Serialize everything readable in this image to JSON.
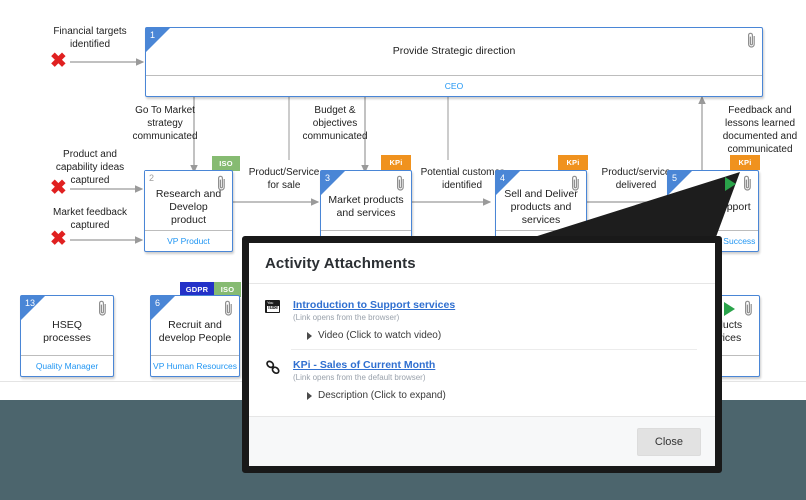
{
  "diagram": {
    "boxes": [
      {
        "num": "1",
        "title": "Provide Strategic direction",
        "role": "CEO",
        "badges": [],
        "has_clip": true,
        "has_play": false
      },
      {
        "num": "2",
        "title": "Research and Develop product",
        "role": "VP Product",
        "badges": [
          "ISO"
        ],
        "has_clip": true,
        "has_play": false
      },
      {
        "num": "3",
        "title": "Market products and services",
        "role": "",
        "badges": [
          "KPi"
        ],
        "has_clip": true,
        "has_play": false
      },
      {
        "num": "4",
        "title": "Sell and Deliver products and services",
        "role": "",
        "badges": [
          "KPi"
        ],
        "has_clip": true,
        "has_play": false
      },
      {
        "num": "5",
        "title": "Provide Support",
        "role": "VP Customer Success",
        "badges": [
          "KPi"
        ],
        "has_clip": true,
        "has_play": true
      },
      {
        "num": "13",
        "title": "HSEQ\nprocesses",
        "role": "Quality Manager",
        "badges": [],
        "has_clip": true,
        "has_play": false
      },
      {
        "num": "6",
        "title": "Recruit and develop People",
        "role": "VP Human Resources",
        "badges": [
          "GDPR",
          "ISO"
        ],
        "has_clip": true,
        "has_play": false
      },
      {
        "num": "",
        "title": "products services",
        "role": "",
        "badges": [],
        "has_clip": true,
        "has_play": true
      }
    ],
    "flow_labels": [
      "Financial targets\nidentified",
      "Go To Market\nstrategy\ncommunicated",
      "Budget &\nobjectives\ncommunicated",
      "Feedback and\nlessons learned\ndocumented and\ncommunicated",
      "Product and\ncapability ideas\ncaptured",
      "Market feedback\ncaptured",
      "Product/Service\nfor sale",
      "Potential customer\nidentified",
      "Product/service\ndelivered"
    ]
  },
  "modal": {
    "title": "Activity Attachments",
    "attachments": [
      {
        "icon": "youtube-icon",
        "link": "Introduction to Support services",
        "sub": "(Link opens from the browser)",
        "row_label": "Video (Click to watch video)"
      },
      {
        "icon": "link-chain-icon",
        "link": "KPi - Sales of Current Month",
        "sub": "(Link opens from the default browser)",
        "row_label": "Description (Click to expand)"
      }
    ],
    "close_label": "Close"
  },
  "colors": {
    "box_border": "#4a86d6",
    "role_text": "#2196f3",
    "badge_iso": "#86bb72",
    "badge_kpi": "#f0921e",
    "badge_gdpr": "#2331c8",
    "x_mark": "#e02020",
    "page_band": "#4c656d",
    "link": "#2f6fd0"
  }
}
